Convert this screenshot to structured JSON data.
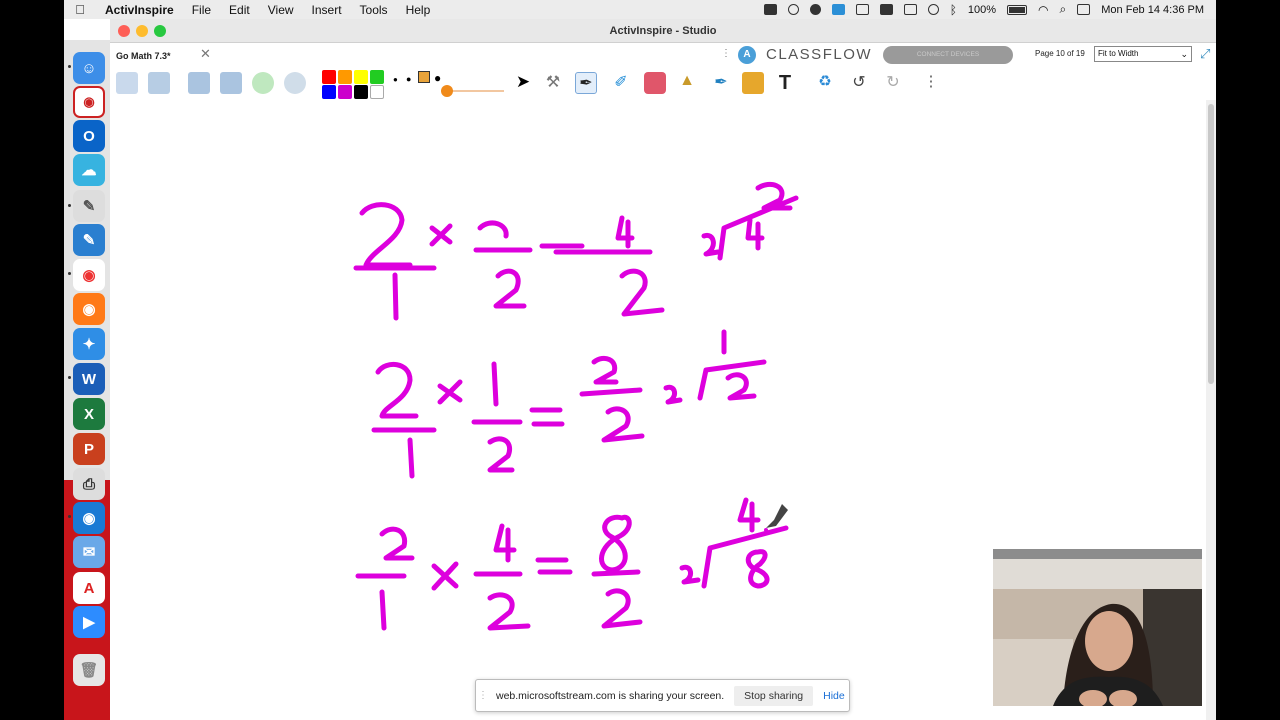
{
  "menubar": {
    "app_name": "ActivInspire",
    "menus": [
      "File",
      "Edit",
      "View",
      "Insert",
      "Tools",
      "Help"
    ],
    "battery": "100%",
    "datetime": "Mon Feb 14  4:36 PM"
  },
  "window": {
    "title": "ActivInspire - Studio"
  },
  "tabbar": {
    "document_tab": "Go Math 7.3*",
    "classflow": "CLASSFLOW",
    "connect_devices": "CONNECT DEVICES",
    "page_info": "Page 10 of 19",
    "zoom": "Fit to Width"
  },
  "toolbar": {
    "palette_colors": [
      "#ff0000",
      "#ff9900",
      "#ffff00",
      "#22cc22",
      "#0000ff",
      "#cc00cc",
      "#000000",
      "#ffffff"
    ],
    "pen_color": "#dd00dd"
  },
  "share": {
    "message": "web.microsoftstream.com is sharing your screen.",
    "stop_label": "Stop sharing",
    "hide_label": "Hide"
  }
}
